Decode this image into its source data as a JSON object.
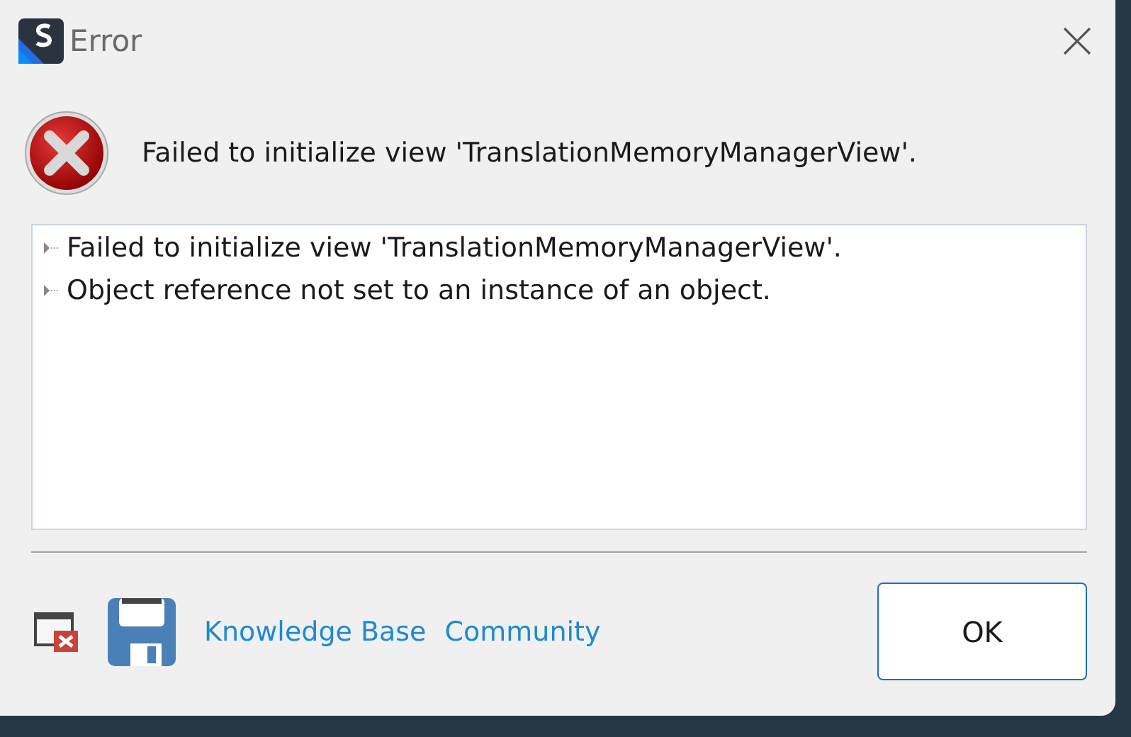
{
  "window": {
    "title": "Error"
  },
  "message": "Failed to initialize view 'TranslationMemoryManagerView'.",
  "details": [
    {
      "text": "Failed to initialize view 'TranslationMemoryManagerView'.",
      "expanded": false
    },
    {
      "text": "Object reference not set to an instance of an object.",
      "expanded": false
    }
  ],
  "links": [
    "Knowledge Base",
    "Community"
  ],
  "buttons": [
    "OK"
  ]
}
